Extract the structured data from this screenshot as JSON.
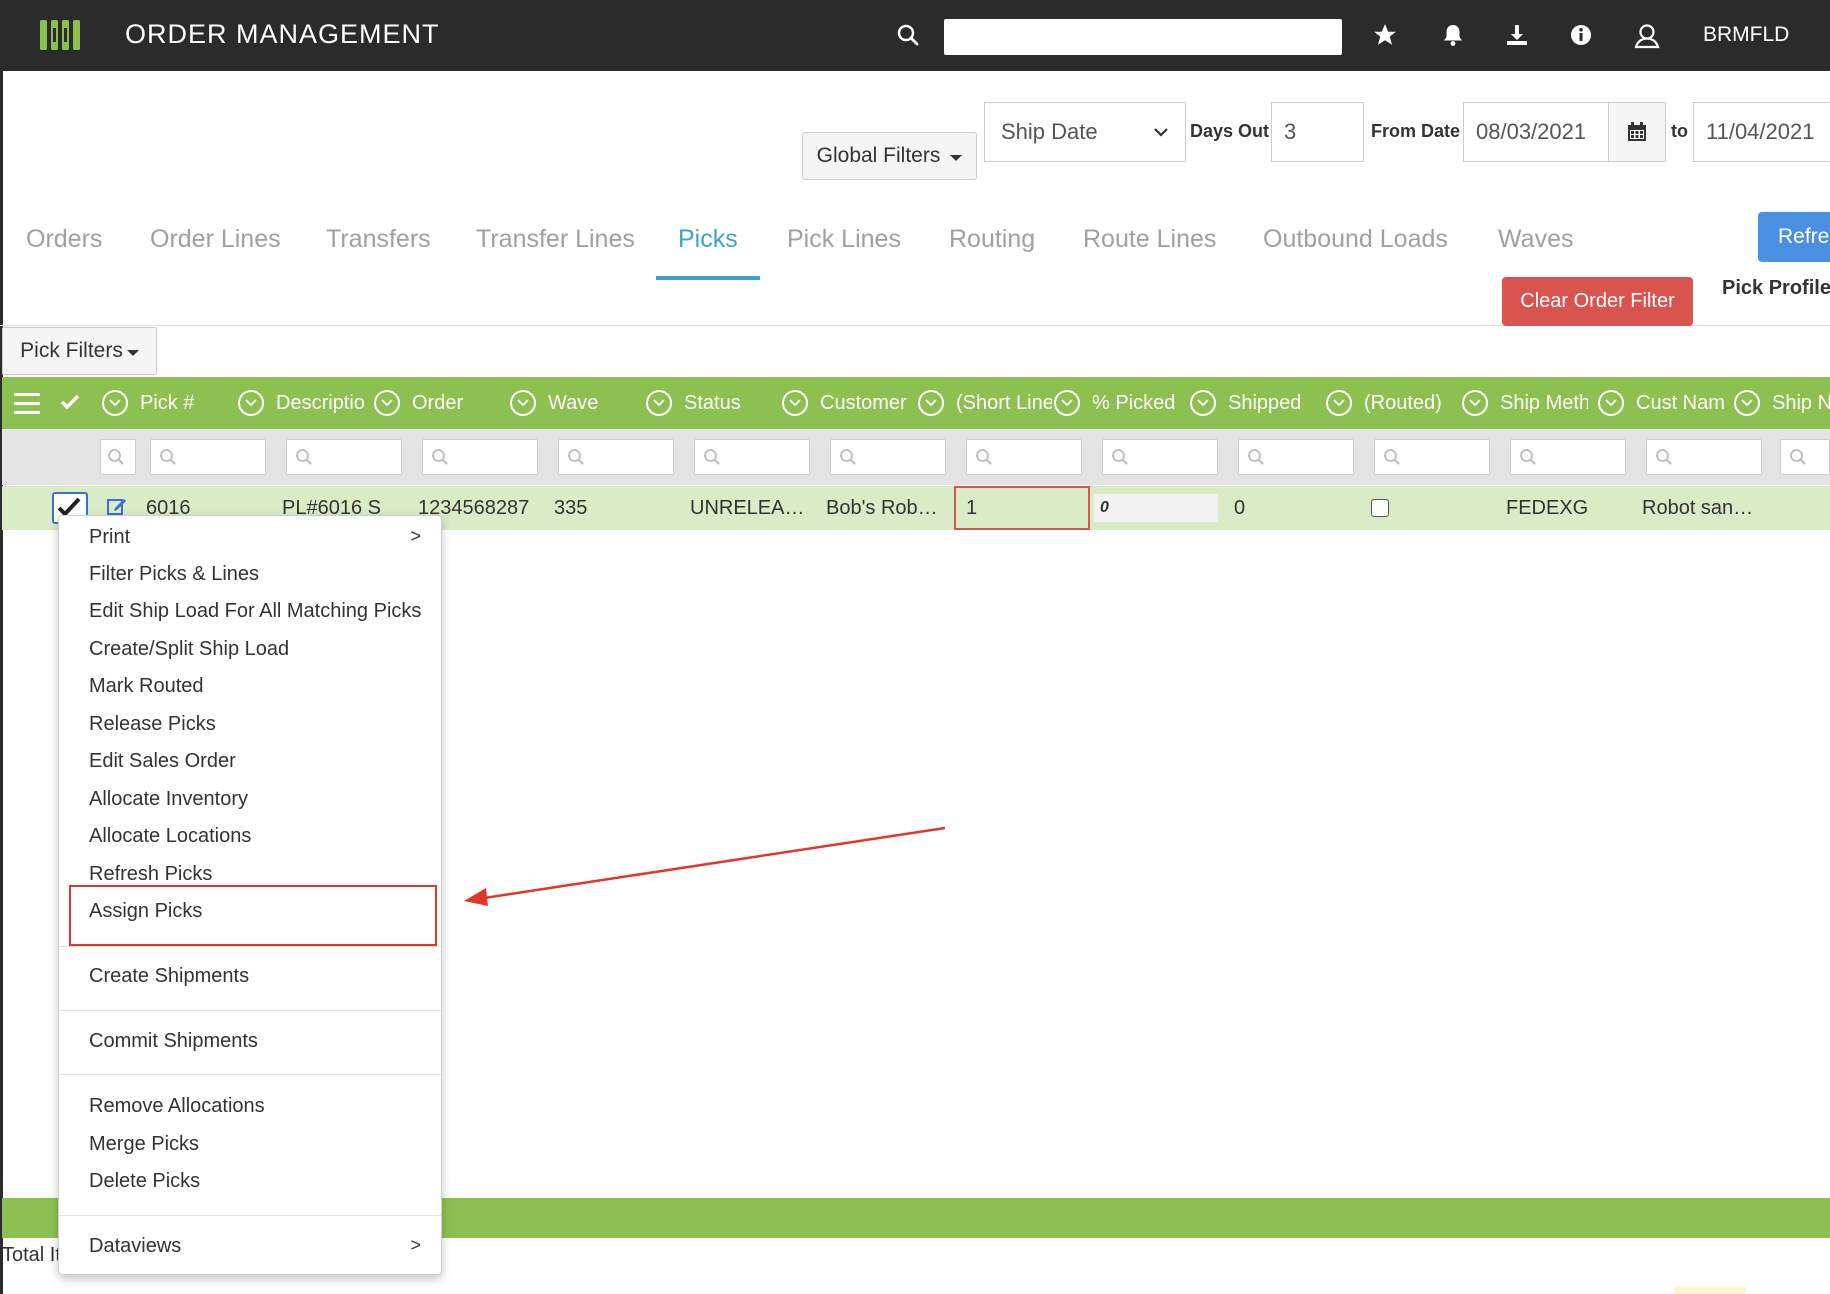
{
  "app": {
    "title": "ORDER MANAGEMENT",
    "username": "BRMFLD",
    "search_value": ""
  },
  "toolbar": {
    "global_filters_label": "Global Filters",
    "date_type_selected": "Ship Date",
    "days_out_label": "Days Out",
    "days_out_value": "3",
    "from_date_label": "From Date",
    "from_date_value": "08/03/2021",
    "to_label": "to",
    "to_date_value": "11/04/2021"
  },
  "tabs": [
    {
      "label": "Orders"
    },
    {
      "label": "Order Lines"
    },
    {
      "label": "Transfers"
    },
    {
      "label": "Transfer Lines"
    },
    {
      "label": "Picks"
    },
    {
      "label": "Pick Lines"
    },
    {
      "label": "Routing"
    },
    {
      "label": "Route Lines"
    },
    {
      "label": "Outbound Loads"
    },
    {
      "label": "Waves"
    }
  ],
  "active_tab": "Picks",
  "actions": {
    "refresh_label": "Refre",
    "clear_order_filter_label": "Clear Order Filter",
    "pick_profile_label": "Pick Profile"
  },
  "pick_filters_label": "Pick Filters",
  "grid": {
    "columns": [
      "Pick #",
      "Descriptio",
      "Order",
      "Wave",
      "Status",
      "Customer",
      "(Short Line",
      "% Picked",
      "Shipped",
      "(Routed)",
      "Ship Meth",
      "Cust Nam",
      "Ship N"
    ],
    "row": {
      "pick": "6016",
      "description": "PL#6016 S",
      "order": "1234568287",
      "wave": "335",
      "status": "UNRELEA…",
      "customer": "Bob's Rob…",
      "short_line": "1",
      "percent_picked": "0",
      "shipped": "0",
      "routed": false,
      "ship_method": "FEDEXG",
      "cust_name": "Robot san…"
    }
  },
  "footer": {
    "total_items_label": "Total It"
  },
  "context_menu": {
    "items": [
      {
        "label": "Print",
        "submenu": true,
        "arrow": ">"
      },
      {
        "label": "Filter Picks & Lines"
      },
      {
        "label": "Edit Ship Load For All Matching Picks"
      },
      {
        "label": "Create/Split Ship Load"
      },
      {
        "label": "Mark Routed"
      },
      {
        "label": "Release Picks"
      },
      {
        "label": "Edit Sales Order"
      },
      {
        "label": "Allocate Inventory"
      },
      {
        "label": "Allocate Locations"
      },
      {
        "label": "Refresh Picks"
      },
      {
        "label": "Assign Picks",
        "highlighted": true
      },
      {
        "label": "Create Shipments"
      },
      {
        "label": "Commit Shipments"
      },
      {
        "label": "Remove Allocations"
      },
      {
        "label": "Merge Picks"
      },
      {
        "label": "Delete Picks"
      },
      {
        "label": "Dataviews",
        "submenu": true,
        "arrow": ">"
      }
    ]
  },
  "colors": {
    "topbar": "#2b2b2b",
    "grid_green": "#8cc152",
    "row_selected": "#d9ecc5",
    "active_tab": "#3ea3c9",
    "danger": "#d9534f",
    "primary": "#4a90e2",
    "annotation_red": "#e0372a"
  },
  "icons": [
    "logo-icon",
    "search-icon",
    "star-icon",
    "bell-icon",
    "download-icon",
    "info-icon",
    "user-icon",
    "calendar-icon",
    "menu-icon",
    "check-icon",
    "chevron-down-icon",
    "edit-icon"
  ]
}
